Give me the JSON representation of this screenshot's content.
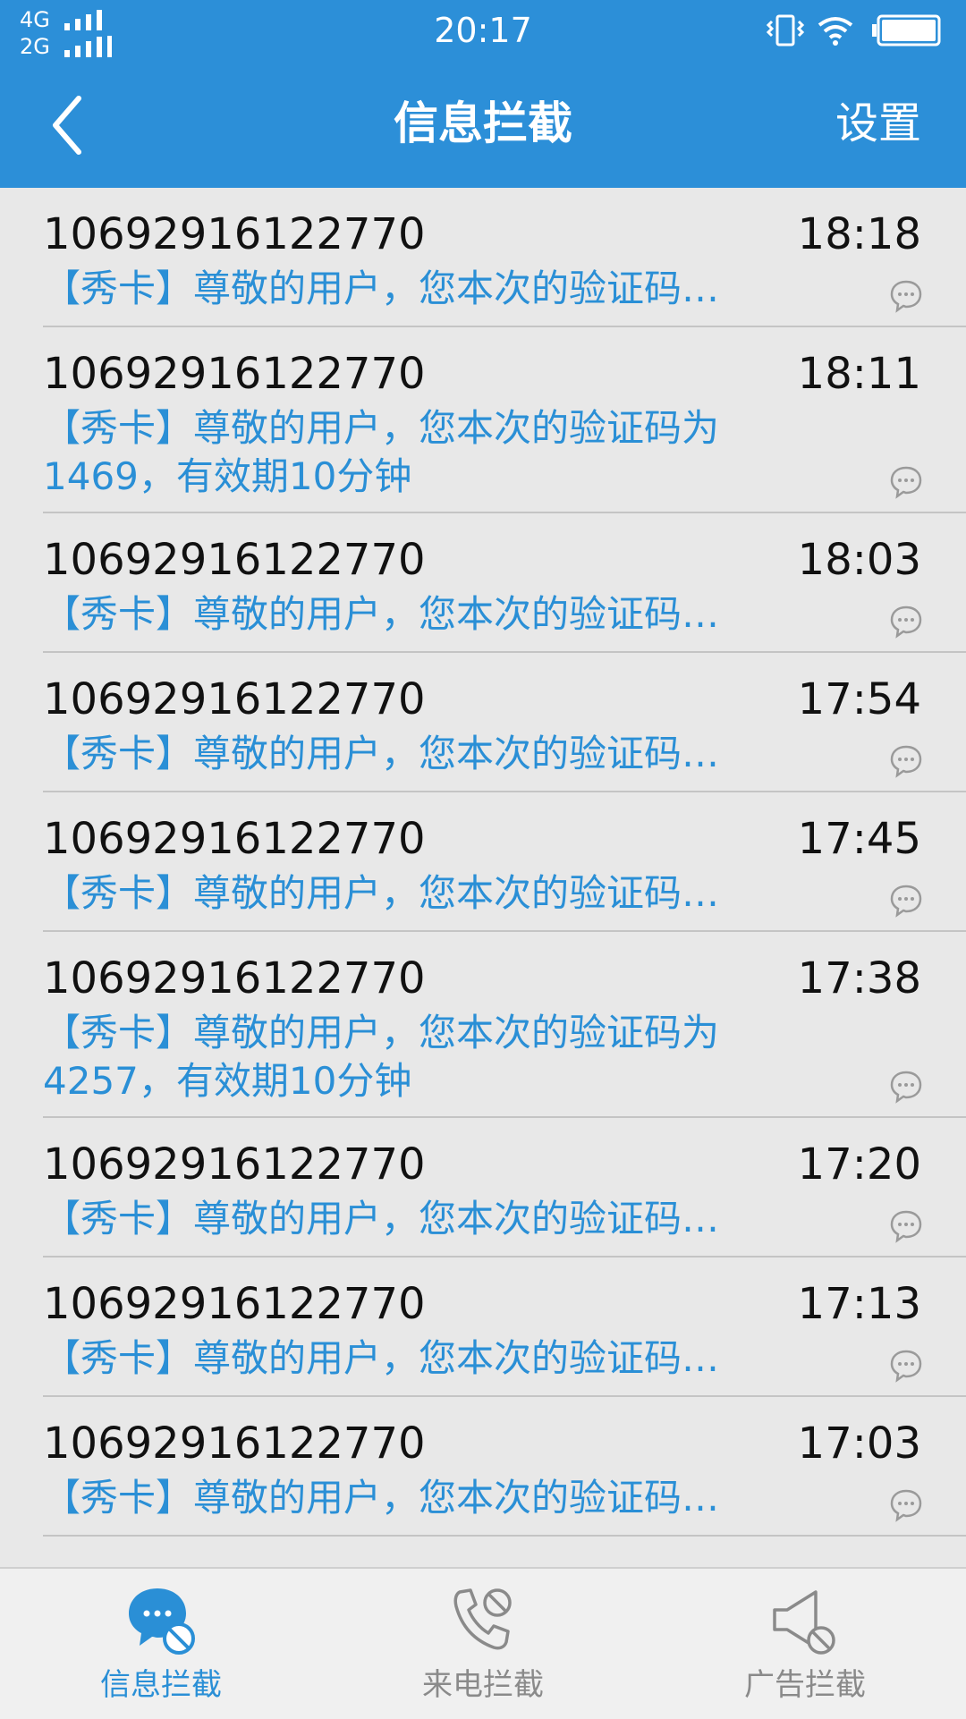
{
  "status_bar": {
    "network_top": "4G",
    "network_bottom": "2G",
    "time": "20:17",
    "icons": [
      "vibrate-icon",
      "wifi-icon",
      "battery-icon"
    ]
  },
  "header": {
    "title": "信息拦截",
    "settings_label": "设置",
    "back_icon": "chevron-left-icon"
  },
  "messages": [
    {
      "sender": "10692916122770",
      "time": "18:18",
      "preview": "【秀卡】尊敬的用户，您本次的验证码…",
      "expanded": false
    },
    {
      "sender": "10692916122770",
      "time": "18:11",
      "preview": "【秀卡】尊敬的用户，您本次的验证码为1469，有效期10分钟",
      "expanded": true
    },
    {
      "sender": "10692916122770",
      "time": "18:03",
      "preview": "【秀卡】尊敬的用户，您本次的验证码…",
      "expanded": false
    },
    {
      "sender": "10692916122770",
      "time": "17:54",
      "preview": "【秀卡】尊敬的用户，您本次的验证码…",
      "expanded": false
    },
    {
      "sender": "10692916122770",
      "time": "17:45",
      "preview": "【秀卡】尊敬的用户，您本次的验证码…",
      "expanded": false
    },
    {
      "sender": "10692916122770",
      "time": "17:38",
      "preview": "【秀卡】尊敬的用户，您本次的验证码为4257，有效期10分钟",
      "expanded": true
    },
    {
      "sender": "10692916122770",
      "time": "17:20",
      "preview": "【秀卡】尊敬的用户，您本次的验证码…",
      "expanded": false
    },
    {
      "sender": "10692916122770",
      "time": "17:13",
      "preview": "【秀卡】尊敬的用户，您本次的验证码…",
      "expanded": false
    },
    {
      "sender": "10692916122770",
      "time": "17:03",
      "preview": "【秀卡】尊敬的用户，您本次的验证码…",
      "expanded": false
    }
  ],
  "bottom_nav": [
    {
      "label": "信息拦截",
      "icon": "message-block-icon",
      "active": true
    },
    {
      "label": "来电拦截",
      "icon": "phone-block-icon",
      "active": false
    },
    {
      "label": "广告拦截",
      "icon": "speaker-block-icon",
      "active": false
    }
  ],
  "colors": {
    "header_bg": "#2c8fd8",
    "accent": "#2a8fd6",
    "list_bg": "#e8e8e8",
    "nav_bg": "#f0f0f0"
  }
}
